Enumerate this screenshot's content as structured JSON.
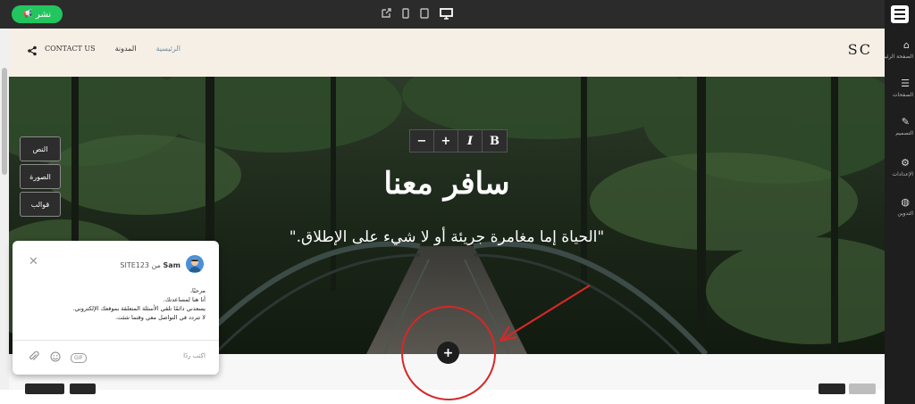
{
  "topbar": {
    "publish_label": "نشر",
    "device_icons": [
      "external-link-icon",
      "mobile-icon",
      "tablet-icon",
      "desktop-icon"
    ],
    "active_device": "desktop-icon"
  },
  "sidebar": {
    "items": [
      {
        "label": "الصفحة الرئيسية",
        "icon": "home-icon"
      },
      {
        "label": "الصفحات",
        "icon": "pages-icon"
      },
      {
        "label": "التصميم",
        "icon": "brush-icon"
      },
      {
        "label": "الإعدادات",
        "icon": "gear-icon"
      },
      {
        "label": "التدوين",
        "icon": "globe-icon"
      }
    ]
  },
  "site": {
    "brand": "SC",
    "nav": [
      {
        "label": "CONTACT US",
        "active": false
      },
      {
        "label": "المدونة",
        "active": false
      },
      {
        "label": "الرئيسية",
        "active": true
      }
    ]
  },
  "format_toolbar": {
    "buttons": [
      "−",
      "+",
      "I",
      "B"
    ]
  },
  "hero": {
    "title": "سافر معنا",
    "subtitle": "\"الحياة إما مغامرة جريئة أو لا شيء على الإطلاق.\""
  },
  "tools": {
    "text": "النص",
    "image": "الصورة",
    "templates": "قوالب"
  },
  "chat": {
    "agent_name": "Sam",
    "agent_from": "من SITE123",
    "messages": [
      "مرحبًا،",
      "أنا هنا لمساعدتك.",
      "يسعدني دائمًا تلقي الأسئلة المتعلقة بموقعك الإلكتروني.",
      "لا تتردد في التواصل معي وقتما شئت."
    ],
    "input_placeholder": "اكتب ردًا",
    "gif_label": "GIF"
  },
  "colors": {
    "publish_green": "#22c55e",
    "header_bg": "#f6efe6",
    "annotation_red": "#d62828",
    "topbar_bg": "#2b2b2b"
  }
}
